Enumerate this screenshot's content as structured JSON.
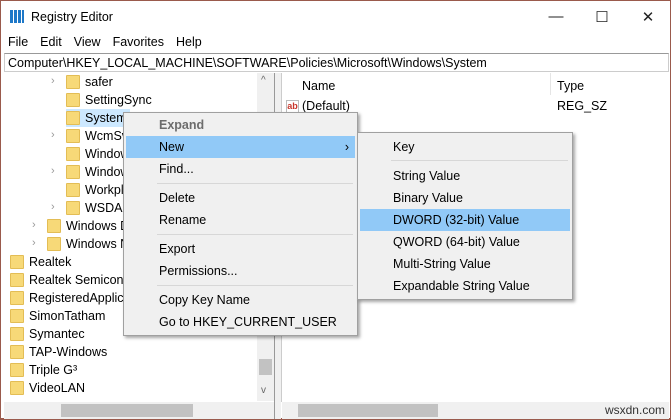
{
  "window": {
    "title": "Registry Editor",
    "minimize": "—",
    "maximize": "☐",
    "close": "✕"
  },
  "menu": [
    "File",
    "Edit",
    "View",
    "Favorites",
    "Help"
  ],
  "address": "Computer\\HKEY_LOCAL_MACHINE\\SOFTWARE\\Policies\\Microsoft\\Windows\\System",
  "tree": [
    {
      "label": "safer",
      "level": 2,
      "expander": true
    },
    {
      "label": "SettingSync",
      "level": 2,
      "expander": false
    },
    {
      "label": "System",
      "level": 2,
      "expander": false,
      "selected": true
    },
    {
      "label": "WcmSvc",
      "level": 2,
      "expander": true
    },
    {
      "label": "Window",
      "level": 2,
      "expander": false
    },
    {
      "label": "Window",
      "level": 2,
      "expander": true
    },
    {
      "label": "Workpl",
      "level": 2,
      "expander": false
    },
    {
      "label": "WSDAP",
      "level": 2,
      "expander": true
    },
    {
      "label": "Windows D",
      "level": 1,
      "expander": true
    },
    {
      "label": "Windows N",
      "level": 1,
      "expander": true
    },
    {
      "label": "Realtek",
      "level": 0
    },
    {
      "label": "Realtek Semicond",
      "level": 0
    },
    {
      "label": "RegisteredApplica",
      "level": 0
    },
    {
      "label": "SimonTatham",
      "level": 0
    },
    {
      "label": "Symantec",
      "level": 0
    },
    {
      "label": "TAP-Windows",
      "level": 0
    },
    {
      "label": "Triple G³",
      "level": 0
    },
    {
      "label": "VideoLAN",
      "level": 0
    }
  ],
  "list": {
    "columns": [
      "Name",
      "Type"
    ],
    "rows": [
      {
        "name": "(Default)",
        "type": "REG_SZ",
        "icon": "ab"
      }
    ]
  },
  "context_menu": {
    "items": [
      "Expand",
      "New",
      "Find...",
      "Delete",
      "Rename",
      "Export",
      "Permissions...",
      "Copy Key Name",
      "Go to HKEY_CURRENT_USER"
    ],
    "arrow": "›"
  },
  "submenu": {
    "items": [
      "Key",
      "String Value",
      "Binary Value",
      "DWORD (32-bit) Value",
      "QWORD (64-bit) Value",
      "Multi-String Value",
      "Expandable String Value"
    ]
  },
  "watermark": "wsxdn.com",
  "colors": {
    "highlight": "#91c9f7",
    "selection": "#cce8ff",
    "border": "#9a5a4c",
    "folder": "#f7d978"
  }
}
